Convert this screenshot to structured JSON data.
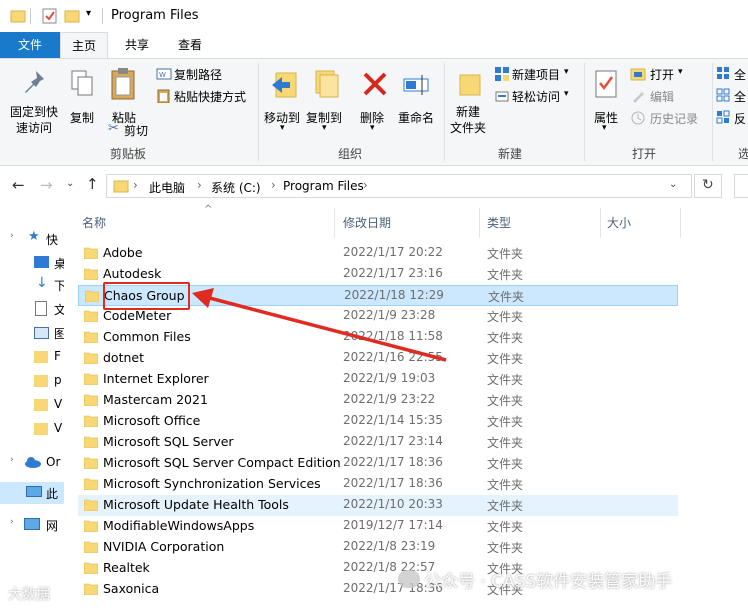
{
  "window": {
    "title": "Program Files"
  },
  "ribbon_tabs": [
    {
      "label": "文件"
    },
    {
      "label": "主页"
    },
    {
      "label": "共享"
    },
    {
      "label": "查看"
    }
  ],
  "ribbon": {
    "clipboard": {
      "pin_line1": "固定到快",
      "pin_line2": "速访问",
      "copy": "复制",
      "paste": "粘贴",
      "copy_path": "复制路径",
      "paste_shortcut": "粘贴快捷方式",
      "cut": "剪切",
      "group": "剪贴板"
    },
    "organize": {
      "move_to": "移动到",
      "copy_to": "复制到",
      "delete": "删除",
      "rename": "重命名",
      "group": "组织"
    },
    "new": {
      "new_folder_line1": "新建",
      "new_folder_line2": "文件夹",
      "new_item": "新建项目",
      "easy_access": "轻松访问",
      "group": "新建"
    },
    "open": {
      "properties": "属性",
      "open": "打开",
      "edit": "编辑",
      "history": "历史记录",
      "group": "打开"
    },
    "select": {
      "line1": "全",
      "line2": "全",
      "line3": "反",
      "group": "选"
    }
  },
  "address": {
    "crumbs": [
      "此电脑",
      "系统 (C:)",
      "Program Files"
    ]
  },
  "columns": {
    "name": "名称",
    "date": "修改日期",
    "type": "类型",
    "size": "大小"
  },
  "nav": [
    {
      "label": "快"
    },
    {
      "label": "桌"
    },
    {
      "label": "下"
    },
    {
      "label": "文"
    },
    {
      "label": "图"
    },
    {
      "label": "F"
    },
    {
      "label": "p"
    },
    {
      "label": "V"
    },
    {
      "label": "V"
    },
    {
      "label": "Or"
    },
    {
      "label": "此"
    },
    {
      "label": "网"
    }
  ],
  "files": [
    {
      "name": "Adobe",
      "date": "2022/1/17 20:22",
      "type": "文件夹"
    },
    {
      "name": "Autodesk",
      "date": "2022/1/17 23:16",
      "type": "文件夹"
    },
    {
      "name": "Chaos Group",
      "date": "2022/1/18 12:29",
      "type": "文件夹"
    },
    {
      "name": "CodeMeter",
      "date": "2022/1/9 23:28",
      "type": "文件夹"
    },
    {
      "name": "Common Files",
      "date": "2022/1/18 11:58",
      "type": "文件夹"
    },
    {
      "name": "dotnet",
      "date": "2022/1/16 22:55",
      "type": "文件夹"
    },
    {
      "name": "Internet Explorer",
      "date": "2022/1/9 19:03",
      "type": "文件夹"
    },
    {
      "name": "Mastercam 2021",
      "date": "2022/1/9 23:22",
      "type": "文件夹"
    },
    {
      "name": "Microsoft Office",
      "date": "2022/1/14 15:35",
      "type": "文件夹"
    },
    {
      "name": "Microsoft SQL Server",
      "date": "2022/1/17 23:14",
      "type": "文件夹"
    },
    {
      "name": "Microsoft SQL Server Compact Edition",
      "date": "2022/1/17 18:36",
      "type": "文件夹"
    },
    {
      "name": "Microsoft Synchronization Services",
      "date": "2022/1/17 18:36",
      "type": "文件夹"
    },
    {
      "name": "Microsoft Update Health Tools",
      "date": "2022/1/10 20:33",
      "type": "文件夹"
    },
    {
      "name": "ModifiableWindowsApps",
      "date": "2019/12/7 17:14",
      "type": "文件夹"
    },
    {
      "name": "NVIDIA Corporation",
      "date": "2022/1/8 23:19",
      "type": "文件夹"
    },
    {
      "name": "Realtek",
      "date": "2022/1/8 22:57",
      "type": "文件夹"
    },
    {
      "name": "Saxonica",
      "date": "2022/1/17 18:36",
      "type": "文件夹"
    }
  ],
  "watermark": {
    "left": "大数据",
    "right": "公众号 · CASS软件安装管家助手"
  },
  "colors": {
    "accent": "#1979ca",
    "selected_row": "#cce8ff",
    "hover_row": "#e5f3ff",
    "annotation": "#e02b20",
    "folder": "#f8d775"
  }
}
